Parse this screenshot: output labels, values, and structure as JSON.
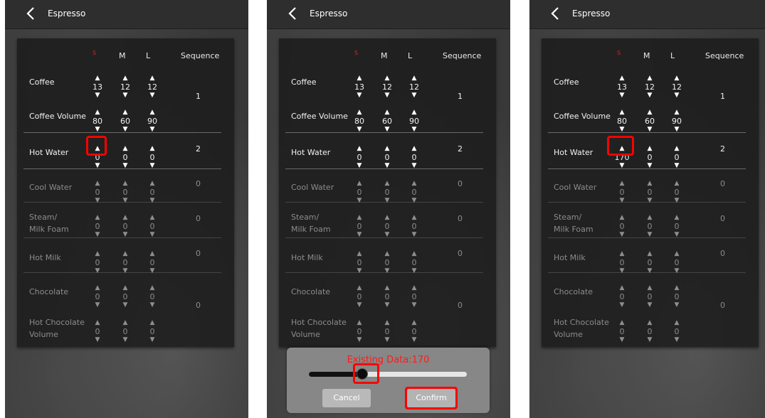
{
  "screens": [
    {
      "title": "Espresso",
      "hot_water_s": "0"
    },
    {
      "title": "Espresso",
      "hot_water_s": "0",
      "dialog": {
        "text": "Existing Data:170",
        "cancel": "Cancel",
        "confirm": "Confirm",
        "slider_fraction": 0.34
      }
    },
    {
      "title": "Espresso",
      "hot_water_s": "170"
    }
  ],
  "columns": {
    "s": "S",
    "m": "M",
    "l": "L",
    "sequence": "Sequence"
  },
  "rows": {
    "coffee": {
      "label": "Coffee",
      "s": "13",
      "m": "12",
      "l": "12"
    },
    "coffee_volume": {
      "label": "Coffee Volume",
      "s": "80",
      "m": "60",
      "l": "90"
    },
    "hot_water": {
      "label": "Hot Water",
      "m": "0",
      "l": "0"
    },
    "cool_water": {
      "label": "Cool Water",
      "s": "0",
      "m": "0",
      "l": "0"
    },
    "steam": {
      "label1": "Steam/",
      "label2": "Milk Foam",
      "s": "0",
      "m": "0",
      "l": "0"
    },
    "hot_milk": {
      "label": "Hot Milk",
      "s": "0",
      "m": "0",
      "l": "0"
    },
    "chocolate": {
      "label": "Chocolate",
      "s": "0",
      "m": "0",
      "l": "0"
    },
    "hot_choc_vol": {
      "label1": "Hot Chocolate",
      "label2": "Volume",
      "s": "0",
      "m": "0",
      "l": "0"
    }
  },
  "sequence": {
    "group1": "1",
    "group2": "2",
    "group3": "0",
    "group4": "0",
    "group5": "0",
    "group6": "0"
  },
  "colors": {
    "highlight": "#ff0000",
    "dialog_text": "#ff1a1a",
    "background": "#383838"
  },
  "icons": {
    "back": "chevron-left-icon",
    "up": "triangle-up-icon",
    "down": "triangle-down-icon"
  }
}
